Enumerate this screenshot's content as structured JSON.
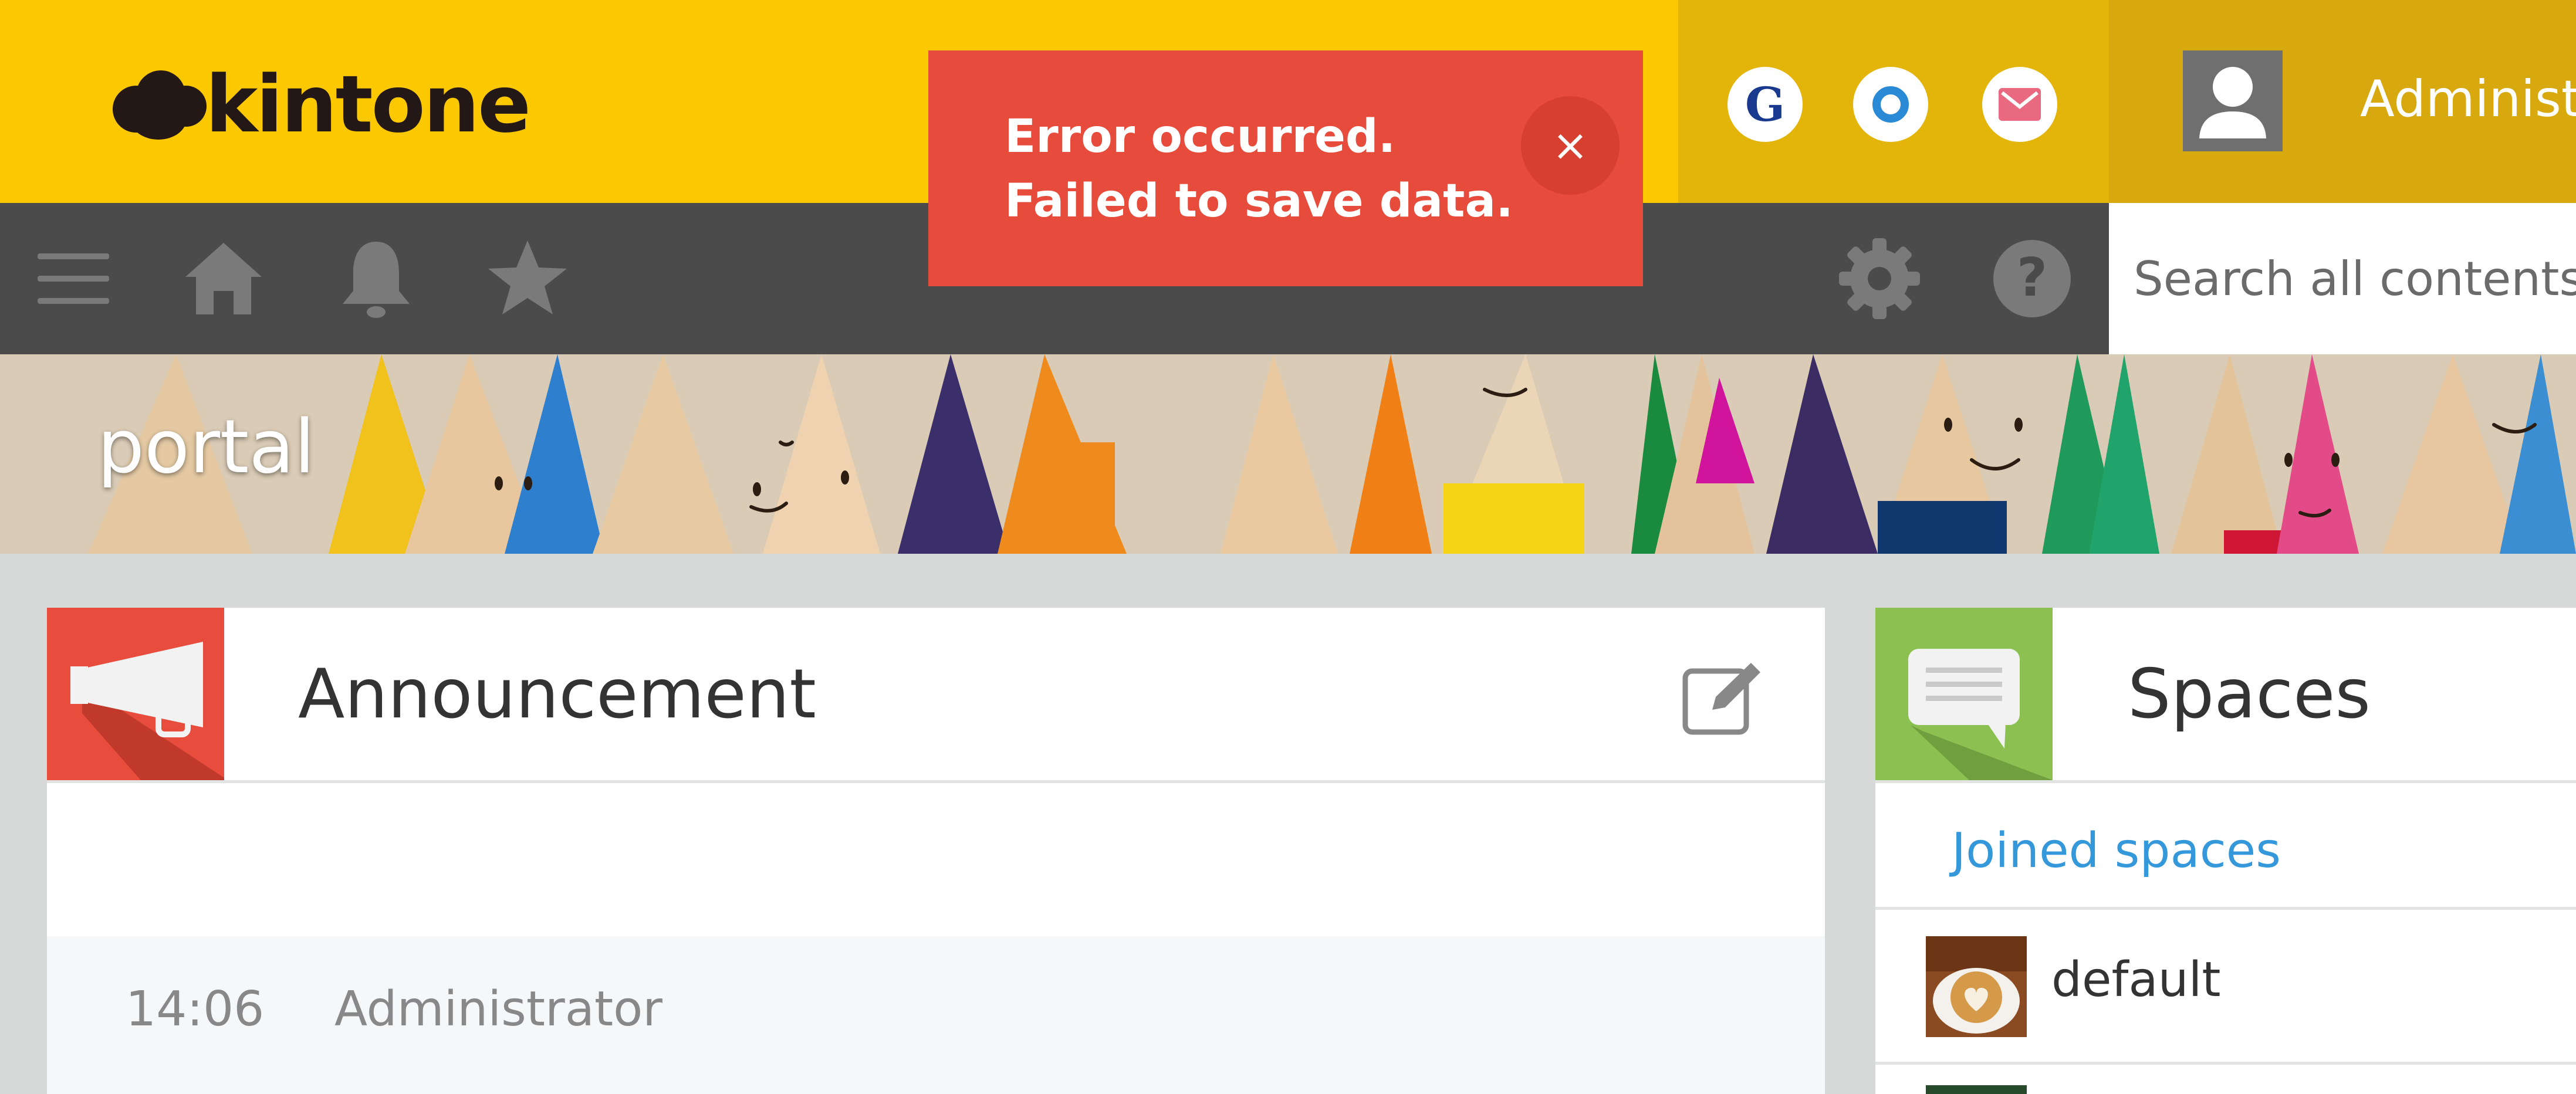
{
  "header": {
    "logo_text": "kintone",
    "app_icons": [
      {
        "name": "g-icon",
        "label": "G",
        "color": "#1a3a8f"
      },
      {
        "name": "o-icon",
        "label": "",
        "color": "#2a8ad6"
      },
      {
        "name": "mail-icon",
        "label": "",
        "color": "#e96a80"
      }
    ],
    "user_name": "Administ"
  },
  "toolbar": {
    "icons": [
      "menu-icon",
      "home-icon",
      "bell-icon",
      "star-icon",
      "gear-icon",
      "help-icon"
    ],
    "search_placeholder": "Search all contents"
  },
  "toast": {
    "message": "Error occurred.\nFailed to save data.",
    "close_label": "×",
    "color": "#e64b3b"
  },
  "banner": {
    "title": "portal"
  },
  "announcement": {
    "title": "Announcement",
    "time": "14:06",
    "author": "Administrator"
  },
  "spaces": {
    "title": "Spaces",
    "tab_label": "Joined spaces",
    "items": [
      {
        "name": "default"
      }
    ]
  }
}
